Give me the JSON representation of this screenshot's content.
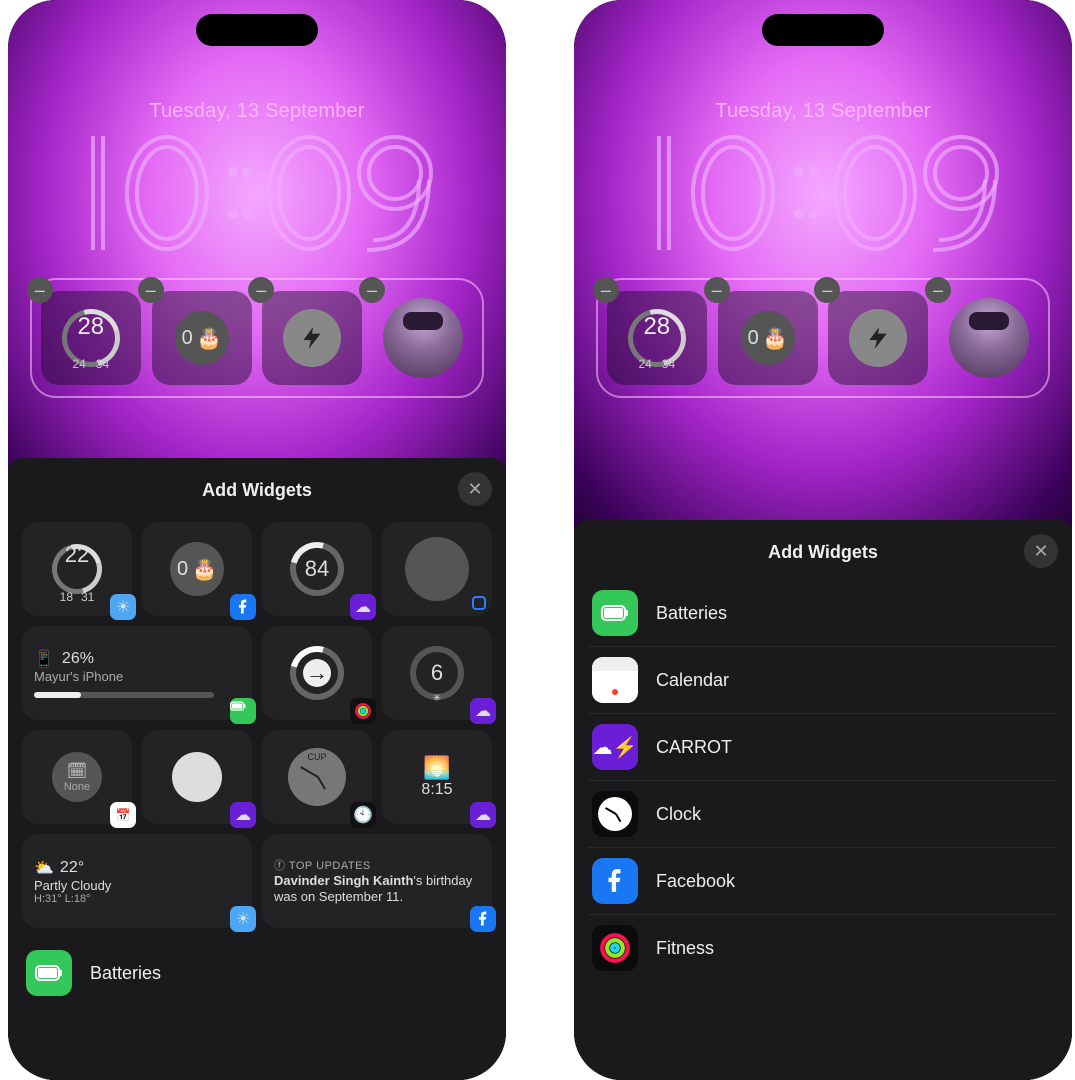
{
  "lockscreen": {
    "date": "Tuesday, 13 September",
    "time_h": "10",
    "time_m": "09",
    "slots": [
      {
        "type": "weather-ring",
        "big": "28",
        "low": "24",
        "high": "34"
      },
      {
        "type": "cake-count",
        "count": "0"
      },
      {
        "type": "bolt"
      },
      {
        "type": "avatar"
      }
    ]
  },
  "sheet_left": {
    "title": "Add Widgets",
    "suggestions_row1": [
      {
        "kind": "weather-ring",
        "big": "22",
        "low": "18",
        "high": "31",
        "badge": "weather"
      },
      {
        "kind": "cake-count",
        "count": "0",
        "badge": "fb"
      },
      {
        "kind": "gauge",
        "big": "84",
        "badge": "carrot"
      },
      {
        "kind": "blank-circle",
        "badge": "none"
      }
    ],
    "battery_wide": {
      "percent": "26%",
      "name": "Mayur's iPhone"
    },
    "row2": [
      {
        "kind": "arrow-ring",
        "badge": "fitness"
      },
      {
        "kind": "num-ring",
        "big": "6",
        "badge": "carrot"
      }
    ],
    "row3": [
      {
        "kind": "none-label",
        "label": "None",
        "badge": "cal"
      },
      {
        "kind": "dot",
        "badge": "carrot"
      },
      {
        "kind": "clock",
        "label": "CUP",
        "badge": "clock"
      },
      {
        "kind": "sunrise",
        "time": "8:15",
        "badge": "carrot"
      }
    ],
    "wide_a": {
      "temp": "22°",
      "cond": "Partly Cloudy",
      "hl": "H:31° L:18°",
      "badge": "weather"
    },
    "wide_b": {
      "header": "TOP UPDATES",
      "bold": "Davinder Singh Kainth",
      "rest": "'s birthday was on September 11.",
      "badge": "fb"
    },
    "app_row": {
      "label": "Batteries"
    }
  },
  "sheet_right": {
    "title": "Add Widgets",
    "apps": [
      {
        "name": "Batteries",
        "color": "#34c759",
        "glyph": "battery"
      },
      {
        "name": "Calendar",
        "color": "#ffffff",
        "glyph": "cal"
      },
      {
        "name": "CARROT",
        "color": "#6a1fd6",
        "glyph": "carrot"
      },
      {
        "name": "Clock",
        "color": "#0b0b0b",
        "glyph": "clock"
      },
      {
        "name": "Facebook",
        "color": "#1977f3",
        "glyph": "fb"
      },
      {
        "name": "Fitness",
        "color": "#0b0b0b",
        "glyph": "fitness"
      }
    ]
  }
}
